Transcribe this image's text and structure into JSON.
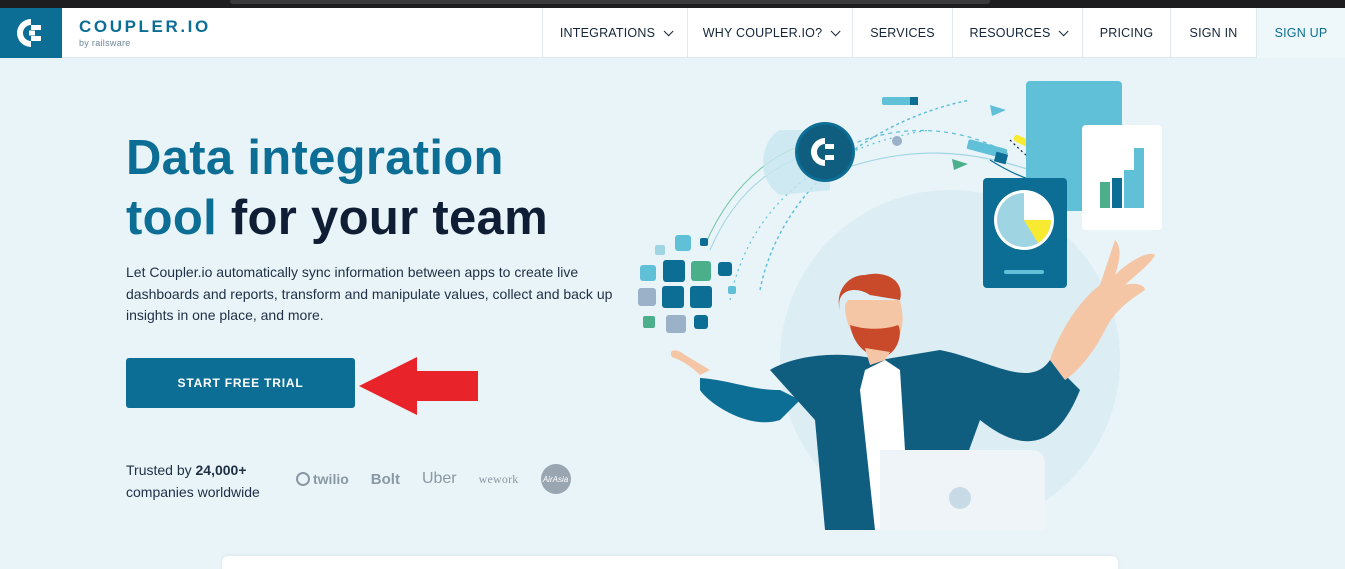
{
  "brand": {
    "name": "COUPLER.IO",
    "byline": "by railsware",
    "color": "#0d6e95"
  },
  "nav": {
    "items": [
      {
        "label": "INTEGRATIONS",
        "dropdown": true
      },
      {
        "label": "WHY COUPLER.IO?",
        "dropdown": true
      },
      {
        "label": "SERVICES",
        "dropdown": false
      },
      {
        "label": "RESOURCES",
        "dropdown": true
      },
      {
        "label": "PRICING",
        "dropdown": false
      },
      {
        "label": "SIGN IN",
        "dropdown": false
      },
      {
        "label": "SIGN UP",
        "dropdown": false
      }
    ]
  },
  "hero": {
    "title_accent_1": "Data integration",
    "title_accent_2": "tool",
    "title_rest": "for your team",
    "description": "Let Coupler.io automatically sync information between apps to create live dashboards and reports, transform and manipulate values, collect and back up insights in one place, and more.",
    "cta_label": "START FREE TRIAL"
  },
  "trusted": {
    "prefix": "Trusted by",
    "count": "24,000+",
    "suffix": "companies worldwide"
  },
  "client_logos": [
    {
      "name": "twilio",
      "text": "twilio"
    },
    {
      "name": "bolt",
      "text": "Bolt"
    },
    {
      "name": "uber",
      "text": "Uber"
    },
    {
      "name": "wework",
      "text": "wework"
    },
    {
      "name": "airasia",
      "text": "AirAsia"
    }
  ],
  "icons": {
    "logo": "coupler-logo-icon",
    "chevron": "chevron-down-icon",
    "arrow": "red-arrow-icon"
  },
  "colors": {
    "accent": "#0d6e95",
    "heading_dark": "#0f1e35",
    "background": "#e9f4f9",
    "annotation_arrow": "#e8232a"
  }
}
